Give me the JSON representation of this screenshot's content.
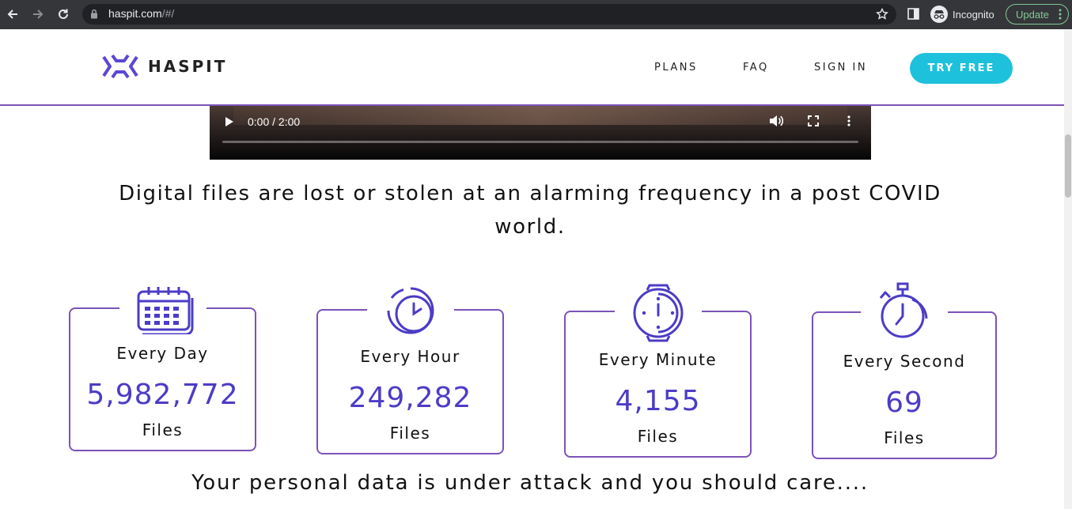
{
  "browser": {
    "url_host": "haspit.com",
    "url_path": "/#/",
    "profile_label": "Incognito",
    "update_label": "Update"
  },
  "header": {
    "brand": "HASPIT",
    "nav": [
      "PLANS",
      "FAQ",
      "SIGN IN"
    ],
    "cta_label": "TRY FREE"
  },
  "video": {
    "time": "0:00 / 2:00"
  },
  "headline": "Digital files are lost or stolen at an alarming frequency in a post COVID world.",
  "stats": [
    {
      "period": "Every Day",
      "count": "5,982,772",
      "unit": "Files",
      "icon": "calendar-icon"
    },
    {
      "period": "Every Hour",
      "count": "249,282",
      "unit": "Files",
      "icon": "clock-icon"
    },
    {
      "period": "Every Minute",
      "count": "4,155",
      "unit": "Files",
      "icon": "watch-icon"
    },
    {
      "period": "Every Second",
      "count": "69",
      "unit": "Files",
      "icon": "stopwatch-icon"
    }
  ],
  "tagline": "Your personal data is under attack and you should care....",
  "colors": {
    "accent": "#4c3cc6",
    "border": "#7b52b9",
    "cta": "#1ec1dc"
  }
}
